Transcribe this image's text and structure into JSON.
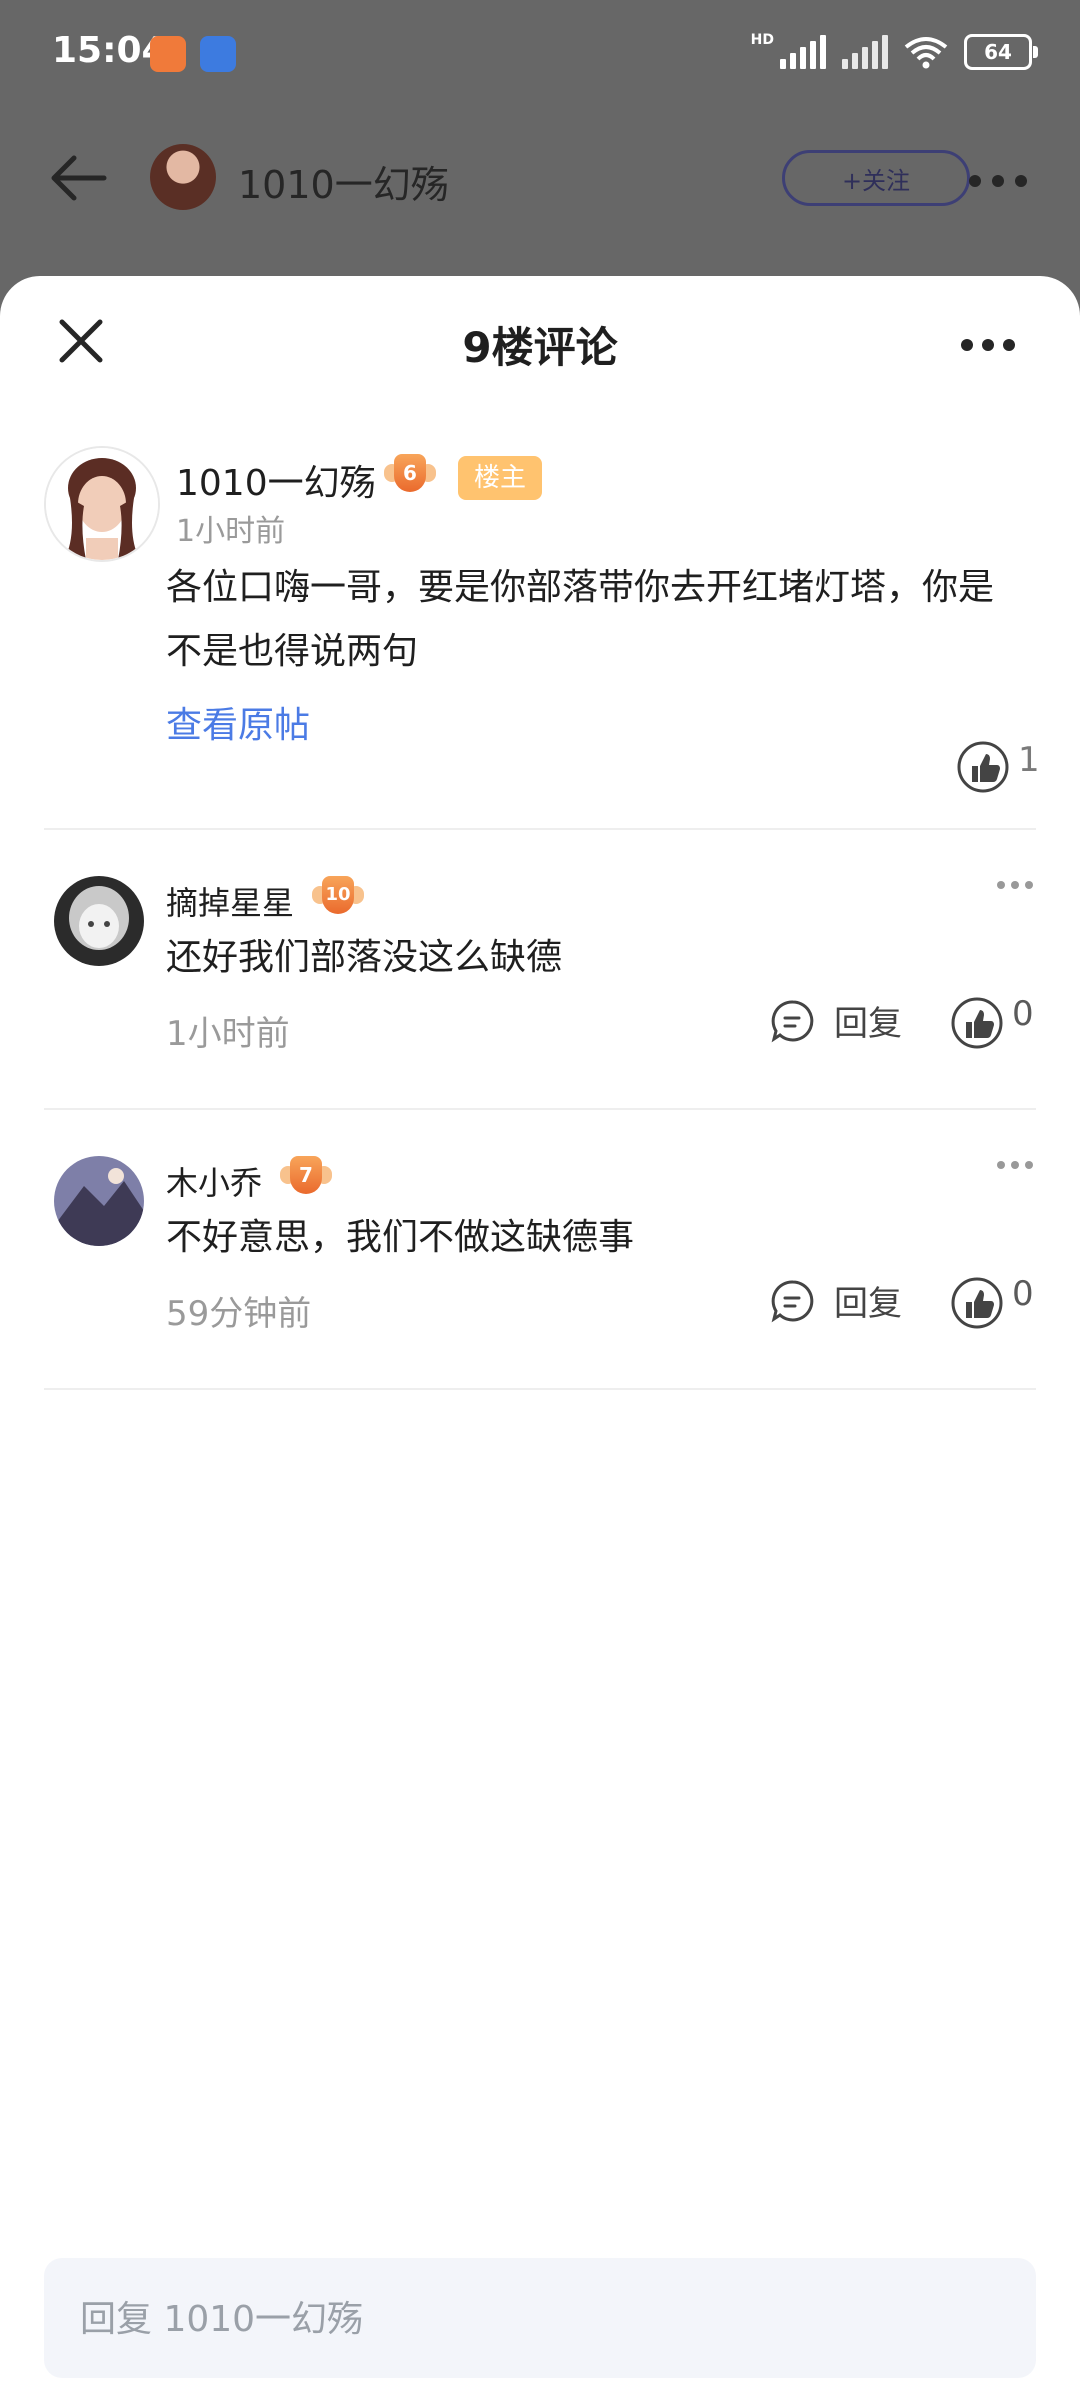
{
  "status_bar": {
    "time": "15:04",
    "hd_label": "HD",
    "battery": "64"
  },
  "top_nav": {
    "username": "1010一幻殇",
    "follow_label": "+关注"
  },
  "sheet": {
    "title": "9楼评论"
  },
  "main_comment": {
    "username": "1010一幻殇",
    "level": "6",
    "owner_tag": "楼主",
    "time": "1小时前",
    "body": "各位口嗨一哥，要是你部落带你去开红堵灯塔，你是不是也得说两句",
    "view_original": "查看原帖",
    "like_count": "1"
  },
  "replies": [
    {
      "username": "摘掉星星",
      "level": "10",
      "body": "还好我们部落没这么缺德",
      "time": "1小时前",
      "reply_label": "回复",
      "like_count": "0"
    },
    {
      "username": "木小乔",
      "level": "7",
      "body": "不好意思，我们不做这缺德事",
      "time": "59分钟前",
      "reply_label": "回复",
      "like_count": "0"
    }
  ],
  "input": {
    "placeholder": "回复 1010一幻殇"
  },
  "colors": {
    "accent_link": "#4b7be5",
    "owner_tag_bg": "#ffc36f",
    "level_badge": "#ea6a2d",
    "overlay": "#676767"
  },
  "icons": {
    "back": "arrow-left-icon",
    "close": "close-icon",
    "more": "more-dots-icon",
    "like": "thumbs-up-icon",
    "reply": "comment-bubble-icon"
  }
}
